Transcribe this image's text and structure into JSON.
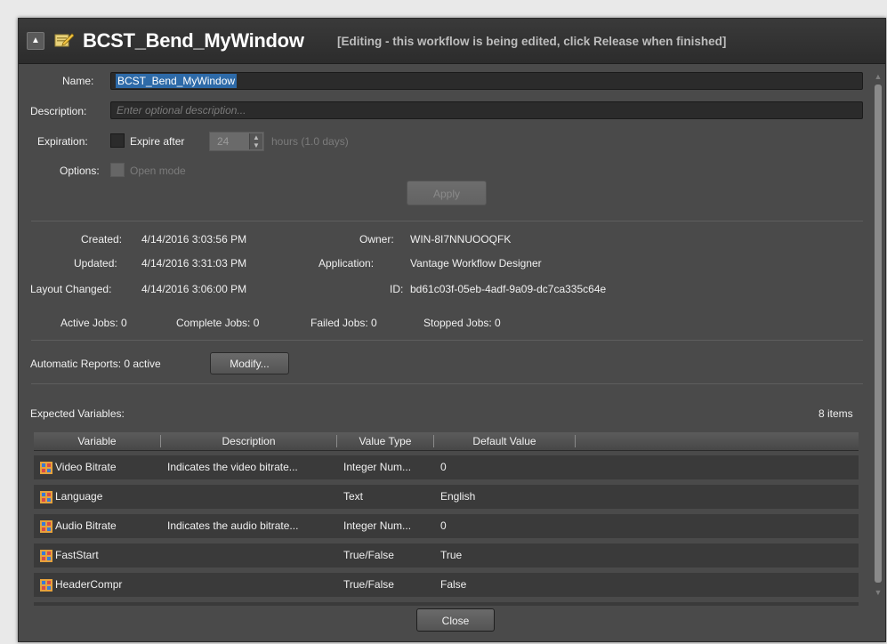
{
  "header": {
    "title": "BCST_Bend_MyWindow",
    "status": "[Editing - this workflow is being edited, click Release when finished]"
  },
  "form": {
    "name_label": "Name:",
    "name_value": "BCST_Bend_MyWindow",
    "description_label": "Description:",
    "description_placeholder": "Enter optional description...",
    "expiration_label": "Expiration:",
    "expire_after_label": "Expire after",
    "expire_value": "24",
    "hours_text": "hours (1.0 days)",
    "options_label": "Options:",
    "open_mode_label": "Open mode",
    "apply_label": "Apply"
  },
  "info": {
    "created_label": "Created:",
    "created_value": "4/14/2016 3:03:56 PM",
    "updated_label": "Updated:",
    "updated_value": "4/14/2016 3:31:03 PM",
    "layout_label": "Layout Changed:",
    "layout_value": "4/14/2016 3:06:00 PM",
    "owner_label": "Owner:",
    "owner_value": "WIN-8I7NNUOOQFK",
    "application_label": "Application:",
    "application_value": "Vantage Workflow Designer",
    "id_label": "ID:",
    "id_value": "bd61c03f-05eb-4adf-9a09-dc7ca335c64e"
  },
  "jobs": {
    "active": "Active Jobs:  0",
    "complete": "Complete Jobs:  0",
    "failed": "Failed Jobs:  0",
    "stopped": "Stopped Jobs:  0"
  },
  "reports": {
    "label": "Automatic Reports:  0 active",
    "modify_label": "Modify..."
  },
  "variables": {
    "title": "Expected Variables:",
    "count": "8 items",
    "columns": [
      "Variable",
      "Description",
      "Value Type",
      "Default Value"
    ],
    "rows": [
      {
        "variable": "Video Bitrate",
        "description": "Indicates the video bitrate...",
        "type": "Integer Num...",
        "default": "0"
      },
      {
        "variable": "Language",
        "description": "",
        "type": "Text",
        "default": "English"
      },
      {
        "variable": "Audio Bitrate",
        "description": "Indicates the audio bitrate...",
        "type": "Integer Num...",
        "default": "0"
      },
      {
        "variable": "FastStart",
        "description": "",
        "type": "True/False",
        "default": "True"
      },
      {
        "variable": "HeaderCompr",
        "description": "",
        "type": "True/False",
        "default": "False"
      }
    ]
  },
  "footer": {
    "close_label": "Close"
  },
  "colors": {
    "selection": "#2d6aa8",
    "panel": "#4a4a4a",
    "title_bar": "#2c2c2c"
  }
}
